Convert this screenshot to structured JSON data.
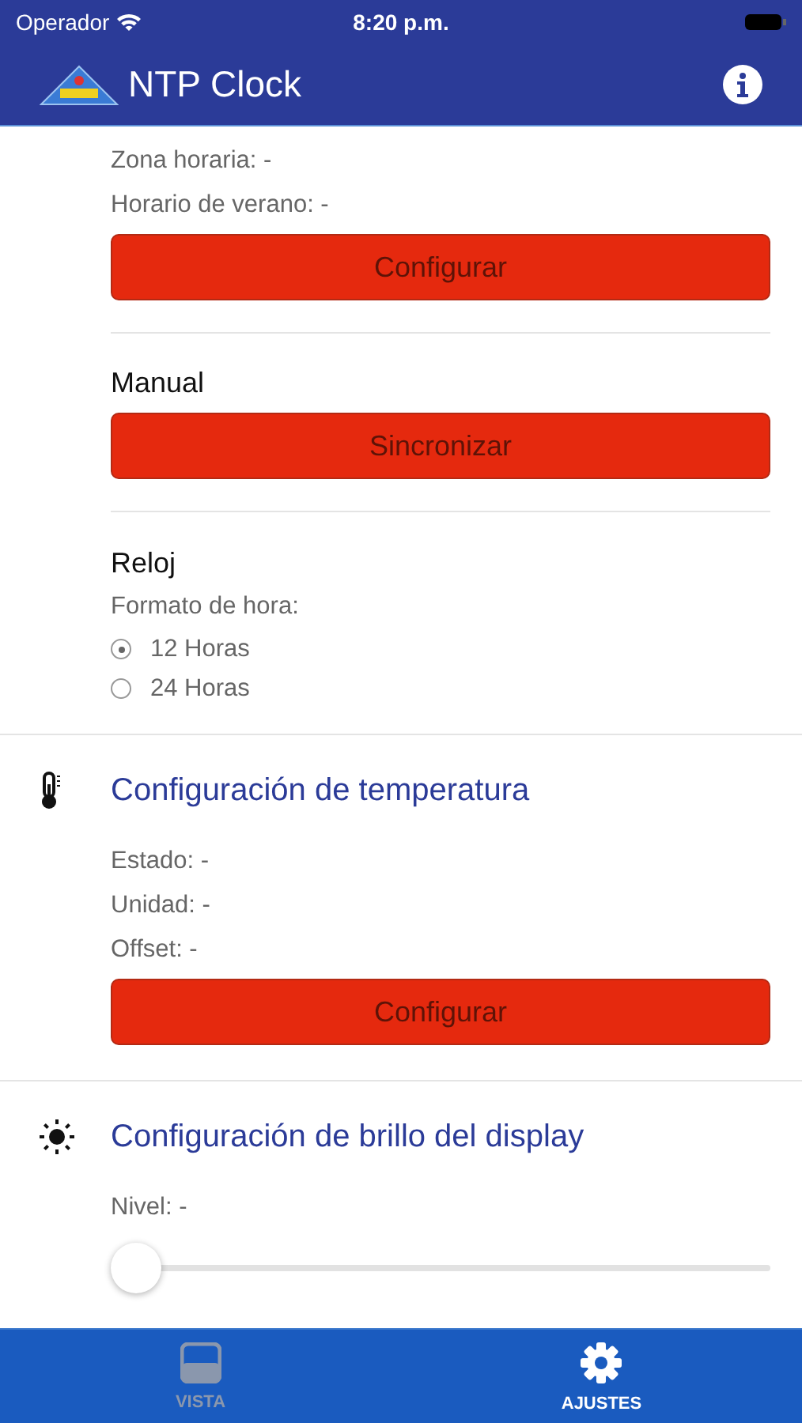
{
  "status_bar": {
    "carrier": "Operador",
    "time": "8:20 p.m."
  },
  "header": {
    "title": "NTP Clock"
  },
  "network": {
    "fields": [
      "Zona horaria: -",
      "Horario de verano: -"
    ],
    "button": {
      "label": "Configurar",
      "disabled": true
    }
  },
  "manual": {
    "title": "Manual",
    "button": {
      "label": "Sincronizar",
      "disabled": true
    }
  },
  "clock": {
    "title": "Reloj",
    "label": "Formato de hora:",
    "options": [
      {
        "label": "12 Horas",
        "selected": true
      },
      {
        "label": "24 Horas",
        "selected": false
      }
    ]
  },
  "temperature": {
    "title": "Configuración de temperatura",
    "fields": [
      "Estado: -",
      "Unidad: -",
      "Offset: -"
    ],
    "button": {
      "label": "Configurar",
      "disabled": true
    }
  },
  "brightness": {
    "title": "Configuración de brillo del display",
    "label": "Nivel: -",
    "level": 0
  },
  "tabs": [
    {
      "label": "VISTA",
      "selected": false
    },
    {
      "label": "AJUSTES",
      "selected": true
    }
  ]
}
